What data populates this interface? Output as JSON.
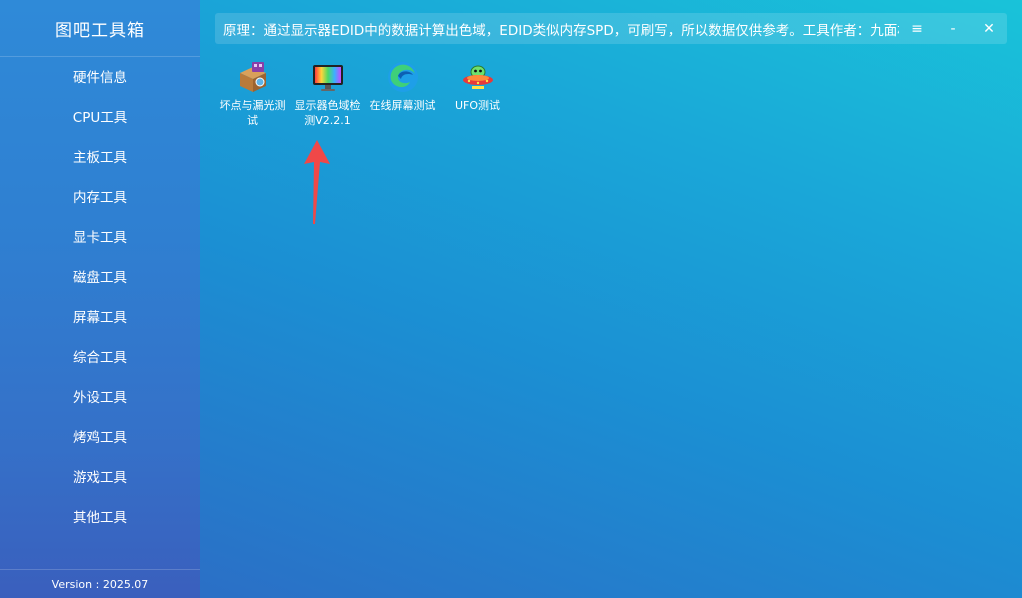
{
  "app": {
    "title": "图吧工具箱",
    "version": "Version : 2025.07"
  },
  "sidebar": {
    "items": [
      {
        "label": "硬件信息"
      },
      {
        "label": "CPU工具"
      },
      {
        "label": "主板工具"
      },
      {
        "label": "内存工具"
      },
      {
        "label": "显卡工具"
      },
      {
        "label": "磁盘工具"
      },
      {
        "label": "屏幕工具"
      },
      {
        "label": "综合工具"
      },
      {
        "label": "外设工具"
      },
      {
        "label": "烤鸡工具"
      },
      {
        "label": "游戏工具"
      },
      {
        "label": "其他工具"
      }
    ]
  },
  "topbar": {
    "notice": "原理：通过显示器EDID中的数据计算出色域，EDID类似内存SPD，可刷写，所以数据仅供参考。工具作者：九面相柳",
    "menu_glyph": "≡",
    "minimize_glyph": "-",
    "close_glyph": "✕"
  },
  "tools": [
    {
      "label": "坏点与漏光测试",
      "icon": "box-package-icon"
    },
    {
      "label": "显示器色域检测V2.2.1",
      "icon": "monitor-rainbow-icon"
    },
    {
      "label": "在线屏幕测试",
      "icon": "edge-browser-icon"
    },
    {
      "label": "UFO测试",
      "icon": "ufo-icon"
    }
  ],
  "colors": {
    "arrow": "#f04848"
  }
}
